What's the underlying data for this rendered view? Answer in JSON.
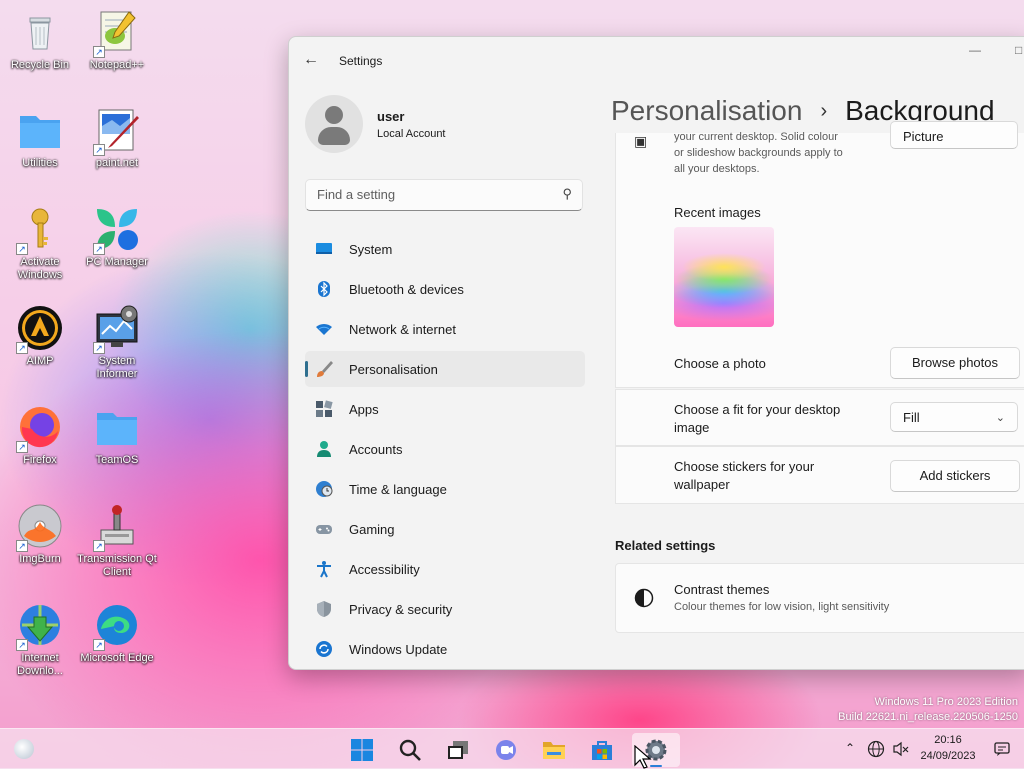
{
  "desktop": {
    "icons": [
      {
        "label": "Recycle Bin",
        "icon": "recycle-bin-icon"
      },
      {
        "label": "Notepad++",
        "icon": "notepad-plus-plus-icon"
      },
      {
        "label": "Utilities",
        "icon": "folder-icon"
      },
      {
        "label": "paint.net",
        "icon": "paint-net-icon"
      },
      {
        "label": "Activate Windows",
        "icon": "key-icon"
      },
      {
        "label": "PC Manager",
        "icon": "pc-manager-icon"
      },
      {
        "label": "AIMP",
        "icon": "aimp-icon"
      },
      {
        "label": "System Informer",
        "icon": "system-informer-icon"
      },
      {
        "label": "Firefox",
        "icon": "firefox-icon"
      },
      {
        "label": "TeamOS",
        "icon": "folder-icon"
      },
      {
        "label": "ImgBurn",
        "icon": "imgburn-icon"
      },
      {
        "label": "Transmission Qt Client",
        "icon": "transmission-icon"
      },
      {
        "label": "Internet Downlo...",
        "icon": "internet-download-manager-icon"
      },
      {
        "label": "Microsoft Edge",
        "icon": "edge-icon"
      }
    ]
  },
  "settings": {
    "title": "Settings",
    "profile": {
      "name": "user",
      "type": "Local Account"
    },
    "search_placeholder": "Find a setting",
    "nav": [
      {
        "label": "System",
        "icon": "system-icon",
        "color": "#0f6cbd"
      },
      {
        "label": "Bluetooth & devices",
        "icon": "bluetooth-icon",
        "color": "#0f6cbd"
      },
      {
        "label": "Network & internet",
        "icon": "wifi-icon",
        "color": "#0f6cbd"
      },
      {
        "label": "Personalisation",
        "icon": "paintbrush-icon",
        "color": "#e07a3a",
        "selected": true
      },
      {
        "label": "Apps",
        "icon": "apps-icon",
        "color": "#4a5a6a"
      },
      {
        "label": "Accounts",
        "icon": "accounts-icon",
        "color": "#1faa8c"
      },
      {
        "label": "Time & language",
        "icon": "globe-clock-icon",
        "color": "#2f7fd0"
      },
      {
        "label": "Gaming",
        "icon": "gamepad-icon",
        "color": "#6f7c8a"
      },
      {
        "label": "Accessibility",
        "icon": "accessibility-icon",
        "color": "#1a75c9"
      },
      {
        "label": "Privacy & security",
        "icon": "shield-icon",
        "color": "#7a8591"
      },
      {
        "label": "Windows Update",
        "icon": "update-icon",
        "color": "#0f6cbd"
      }
    ],
    "breadcrumb": {
      "parent": "Personalisation",
      "separator": "›",
      "current": "Background"
    },
    "background_desc": [
      "your current desktop. Solid colour",
      "or slideshow backgrounds apply to",
      "all your desktops."
    ],
    "background_type_value": "Picture",
    "recent_images_label": "Recent images",
    "choose_photo": {
      "label": "Choose a photo",
      "button": "Browse photos"
    },
    "choose_fit": {
      "label": "Choose a fit for your desktop image",
      "value": "Fill"
    },
    "choose_stickers": {
      "label": "Choose stickers for your wallpaper",
      "button": "Add stickers"
    },
    "related_settings": {
      "heading": "Related settings",
      "contrast": {
        "title": "Contrast themes",
        "subtitle": "Colour themes for low vision, light sensitivity"
      }
    }
  },
  "watermark": {
    "line1": "Windows 11 Pro 2023 Edition",
    "line2": "Build 22621.ni_release.220506-1250"
  },
  "taskbar": {
    "apps": [
      "start-icon",
      "search-icon",
      "task-view-icon",
      "teams-chat-icon",
      "file-explorer-icon",
      "microsoft-store-icon",
      "settings-icon"
    ],
    "tray": {
      "time": "20:16",
      "date": "24/09/2023",
      "icons": [
        "chevron-up-icon",
        "globe-icon",
        "volume-muted-icon",
        "notifications-icon"
      ]
    }
  }
}
